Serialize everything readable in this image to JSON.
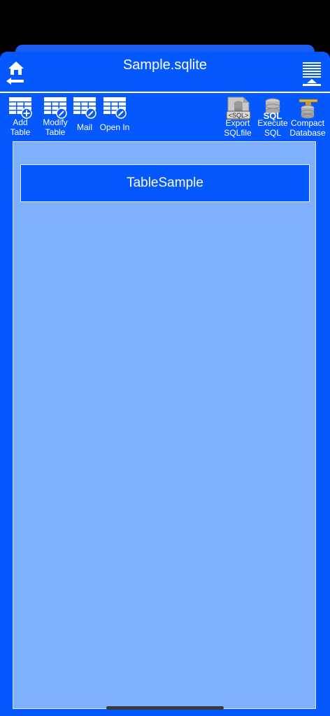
{
  "header": {
    "title": "Sample.sqlite"
  },
  "toolbar": {
    "add_table": "Add\nTable",
    "modify_table": "Modify\nTable",
    "mail": "Mail",
    "open_in": "Open In",
    "export_sqlfile": "Export\nSQLfile",
    "execute_sql": "Execute\nSQL",
    "compact_database": "Compact\nDatabase",
    "sql_badge": "<SQL>",
    "sql_text": "SQL"
  },
  "tables": [
    {
      "name": "TableSample"
    }
  ],
  "colors": {
    "accent": "#0558fd",
    "content_bg": "#7eb0ff"
  }
}
